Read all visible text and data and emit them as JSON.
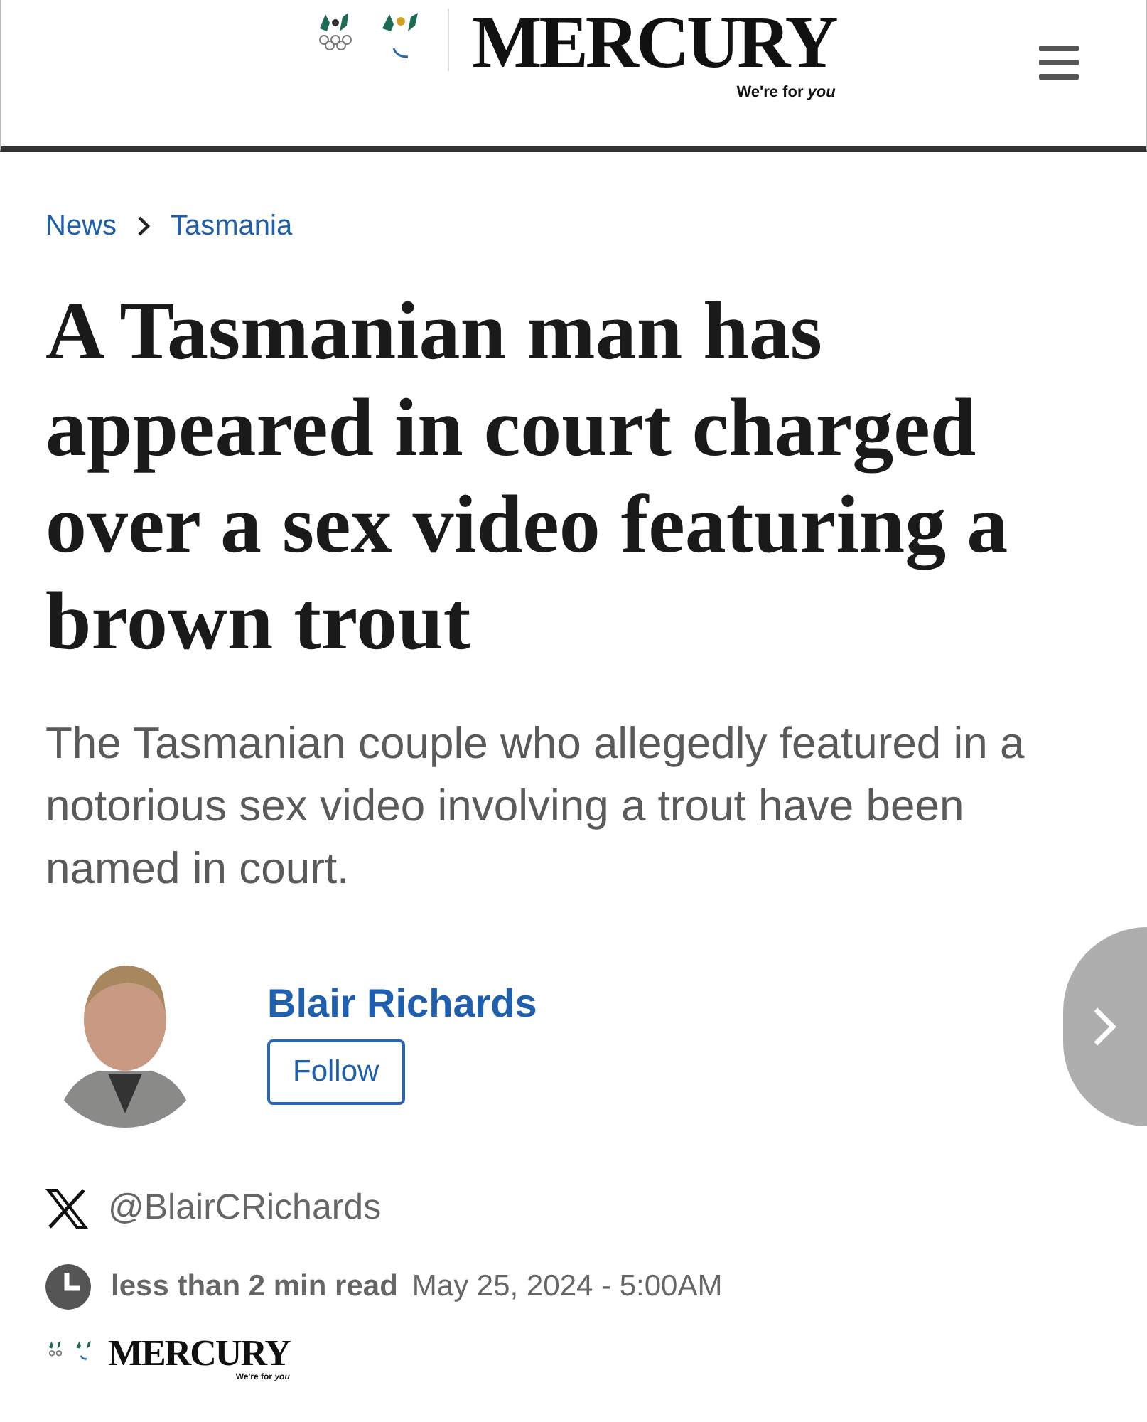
{
  "header": {
    "logo": "MERCURY",
    "tagline": "We're for *you*"
  },
  "breadcrumb": [
    "News",
    "Tasmania"
  ],
  "headline": "A Tasmanian man has appeared in court charged over a sex video featuring a brown trout",
  "standfirst": "The Tasmanian couple who allegedly featured in a notorious sex video involving a trout have been named in court.",
  "author": {
    "name": "Blair Richards",
    "follow_button": "Follow",
    "handle": "@BlairCRichards"
  },
  "meta": {
    "read_time": "less than 2 min read",
    "date": "May 25, 2024 - 5:00AM"
  },
  "footer_logo": {
    "logo": "MERCURY",
    "tagline": "We're for *you*"
  }
}
